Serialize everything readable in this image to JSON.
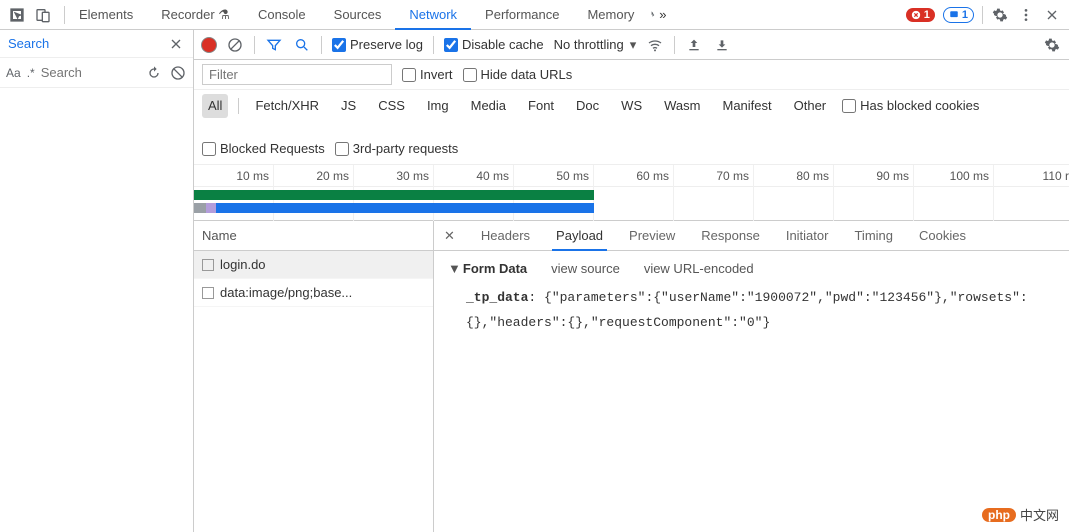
{
  "top": {
    "tabs": [
      "Elements",
      "Recorder",
      "Console",
      "Sources",
      "Network",
      "Performance",
      "Memory"
    ],
    "active_tab": "Network",
    "error_count": "1",
    "info_count": "1"
  },
  "sidebar": {
    "title": "Search",
    "placeholder": "Search"
  },
  "net_toolbar": {
    "preserve_log": "Preserve log",
    "disable_cache": "Disable cache",
    "throttling": "No throttling"
  },
  "filter": {
    "placeholder": "Filter",
    "invert": "Invert",
    "hide_data_urls": "Hide data URLs"
  },
  "types": {
    "items": [
      "All",
      "Fetch/XHR",
      "JS",
      "CSS",
      "Img",
      "Media",
      "Font",
      "Doc",
      "WS",
      "Wasm",
      "Manifest",
      "Other"
    ],
    "active": "All",
    "has_blocked": "Has blocked cookies",
    "blocked_requests": "Blocked Requests",
    "third_party": "3rd-party requests"
  },
  "timeline": {
    "ticks": [
      "10 ms",
      "20 ms",
      "30 ms",
      "40 ms",
      "50 ms",
      "60 ms",
      "70 ms",
      "80 ms",
      "90 ms",
      "100 ms",
      "110 r"
    ]
  },
  "requests": {
    "header": "Name",
    "items": [
      {
        "name": "login.do"
      },
      {
        "name": "data:image/png;base..."
      }
    ]
  },
  "detail": {
    "tabs": [
      "Headers",
      "Payload",
      "Preview",
      "Response",
      "Initiator",
      "Timing",
      "Cookies"
    ],
    "active": "Payload",
    "section_label": "Form Data",
    "view_source": "view source",
    "view_url_encoded": "view URL-encoded",
    "form_key": "_tp_data",
    "form_value": "{\"parameters\":{\"userName\":\"1900072\",\"pwd\":\"123456\"},\"rowsets\":{},\"headers\":{},\"requestComponent\":\"0\"}"
  },
  "watermark": {
    "badge": "php",
    "text": "中文网"
  }
}
